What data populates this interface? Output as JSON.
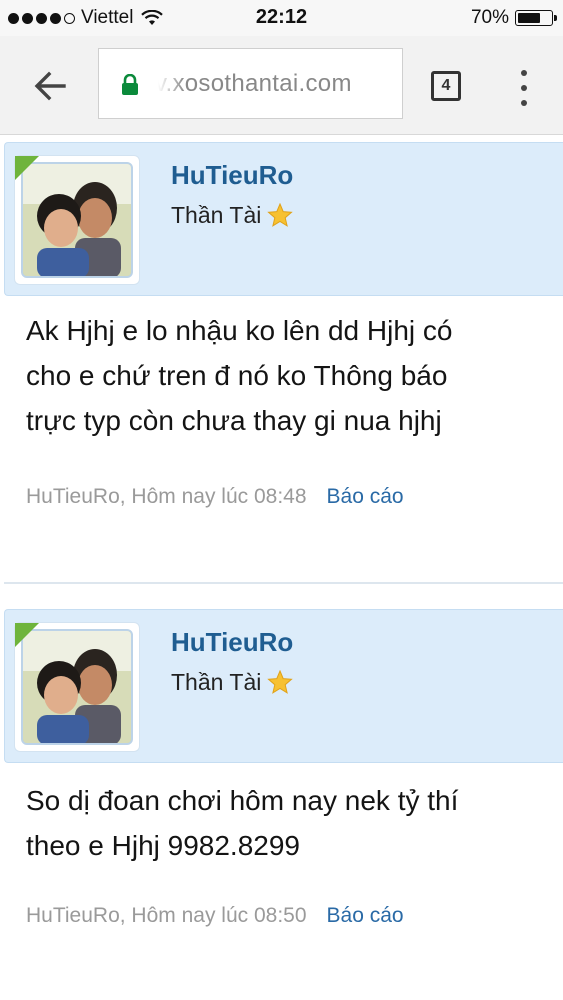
{
  "status_bar": {
    "carrier": "Viettel",
    "time": "22:12",
    "battery_percent": "70%",
    "battery_level": 0.7
  },
  "browser": {
    "url": "v.xosothantai.com",
    "tab_count": "4",
    "icons": {
      "back": "back-arrow-icon",
      "lock": "lock-icon",
      "menu": "more-vert-icon"
    }
  },
  "posts": [
    {
      "username": "HuTieuRo",
      "user_title": "Thần Tài",
      "body_lines": [
        "Ak Hjhj e lo nhậu ko lên dd Hjhj có",
        "cho e chứ tren đ nó ko Thông báo",
        "trực typ còn chưa thay gi nua hjhj"
      ],
      "meta": "HuTieuRo, Hôm nay lúc 08:48",
      "report": "Báo cáo"
    },
    {
      "username": "HuTieuRo",
      "user_title": "Thần Tài",
      "body_lines": [
        "So dị đoan chơi hôm nay nek tỷ thí",
        "theo e Hjhj 9982.8299"
      ],
      "meta": "HuTieuRo, Hôm nay lúc 08:50",
      "report": "Báo cáo"
    }
  ],
  "colors": {
    "header_bg": "#dcecfa",
    "username": "#1f5d91",
    "link": "#2a6aa6",
    "online": "#6fb43c"
  }
}
